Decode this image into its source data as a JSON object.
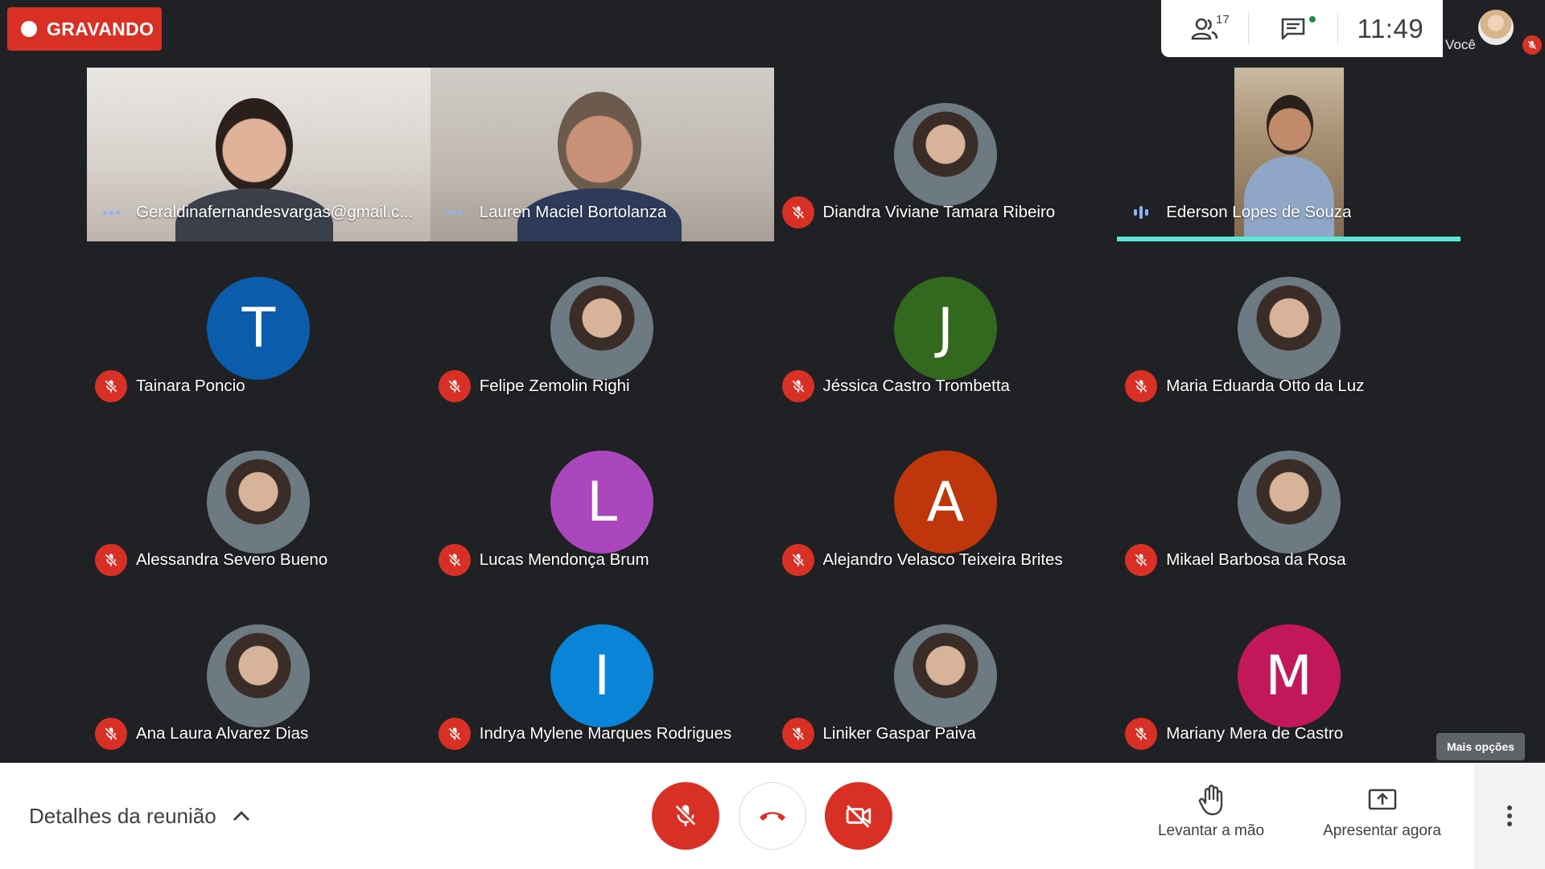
{
  "recording": {
    "label": "GRAVANDO"
  },
  "top_info": {
    "people_count": "17",
    "time": "11:49",
    "self_label": "Você"
  },
  "tiles": [
    {
      "name": "Geraldinafernandesvargas@gmail.c...",
      "kind": "video",
      "status": "dots"
    },
    {
      "name": "Lauren Maciel Bortolanza",
      "kind": "video",
      "status": "dots"
    },
    {
      "name": "Diandra Viviane Tamara Ribeiro",
      "kind": "photo",
      "status": "muted"
    },
    {
      "name": "Ederson Lopes de Souza",
      "kind": "video-narrow",
      "status": "speaking"
    },
    {
      "name": "Tainara Poncio",
      "kind": "initial",
      "initial": "T",
      "color": "#0b5cab",
      "status": "muted"
    },
    {
      "name": "Felipe Zemolin Righi",
      "kind": "photo",
      "status": "muted"
    },
    {
      "name": "Jéssica Castro Trombetta",
      "kind": "initial",
      "initial": "J",
      "color": "#33691e",
      "status": "muted"
    },
    {
      "name": "Maria Eduarda Otto da Luz",
      "kind": "photo",
      "status": "muted"
    },
    {
      "name": "Alessandra Severo Bueno",
      "kind": "photo",
      "status": "muted"
    },
    {
      "name": "Lucas Mendonça Brum",
      "kind": "initial",
      "initial": "L",
      "color": "#ab47bc",
      "status": "muted"
    },
    {
      "name": "Alejandro Velasco Teixeira Brites",
      "kind": "initial",
      "initial": "A",
      "color": "#bf360c",
      "status": "muted"
    },
    {
      "name": "Mikael Barbosa da Rosa",
      "kind": "photo",
      "status": "muted"
    },
    {
      "name": "Ana Laura Alvarez Dias",
      "kind": "photo",
      "status": "muted"
    },
    {
      "name": "Indrya Mylene Marques Rodrigues",
      "kind": "initial",
      "initial": "I",
      "color": "#0a84d6",
      "status": "muted"
    },
    {
      "name": "Liniker Gaspar Paiva",
      "kind": "photo",
      "status": "muted"
    },
    {
      "name": "Mariany Mera de Castro",
      "kind": "initial",
      "initial": "M",
      "color": "#c2185b",
      "status": "muted"
    }
  ],
  "tooltip": {
    "label": "Mais opções"
  },
  "bottom": {
    "details_label": "Detalhes da reunião",
    "raise_hand_label": "Levantar a mão",
    "present_label": "Apresentar agora"
  },
  "colors": {
    "recording": "#d93025",
    "muted": "#d93025",
    "speaking_bar": "#5de6d6",
    "background": "#202124"
  },
  "icons": {
    "people": "people-icon",
    "chat": "chat-icon",
    "mic_off": "mic-off-icon",
    "hangup": "hangup-icon",
    "camera_off": "camera-off-icon",
    "hand": "hand-icon",
    "present": "present-icon",
    "more": "more-vert-icon"
  }
}
